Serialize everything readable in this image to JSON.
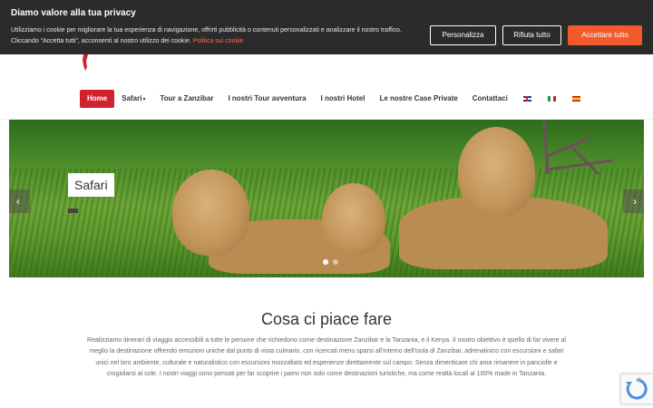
{
  "cookie": {
    "title": "Diamo valore alla tua privacy",
    "text": "Utilizziamo i cookie per migliorare la tua esperienza di navigazione, offrirti pubblicità o contenuti personalizzati e analizzare il nostro traffico. Cliccando “Accetta tutti”, acconsenti al nostro utilizzo dei cookie. ",
    "link": "Politica sui cookie",
    "buttons": {
      "customize": "Personalizza",
      "reject": "Rifiuta tutto",
      "accept": "Accettare tutto"
    }
  },
  "nav": {
    "items": [
      "Home",
      "Safari",
      "Tour a Zanzibar",
      "I nostri Tour avventura",
      "I nostri Hotel",
      "Le nostre Case Private",
      "Contattaci"
    ],
    "caret": "▾",
    "languages": [
      "en-flag-icon",
      "it-flag-icon",
      "es-flag-icon"
    ]
  },
  "slider": {
    "caption": "Safari",
    "prev": "‹",
    "next": "›",
    "dots": 2,
    "active_dot": 1
  },
  "content": {
    "title": "Cosa ci piace fare",
    "text": "Realizziamo itinerari di viaggio accessibili a tutte le persone che richiedono come destinazione Zanzibar e la Tanzania, e il Kenya. Il nostro obiettivo è quello di far vivere al meglio la destinazione offrendo emozioni uniche dal punto di vista culinario, con ricercati menu sparsi all'interno dell'isola di Zanzibar, adrenalinico con escursioni e safari unici nel loro ambiente, culturale e naturalistico con escursioni mozzafiato ed esperienze direttamente sul campo. Senza dimenticare chi ama rimanere in panciolle e crogiolarsi al sole. I nostri viaggi sono pensati per far scoprire i paesi non solo come destinazioni turistiche, ma come realtà locali al 100% made in Tanzania."
  },
  "colors": {
    "brand_red": "#d1222e",
    "accept_orange": "#f15a2b",
    "banner_bg": "#2b2b2b"
  }
}
